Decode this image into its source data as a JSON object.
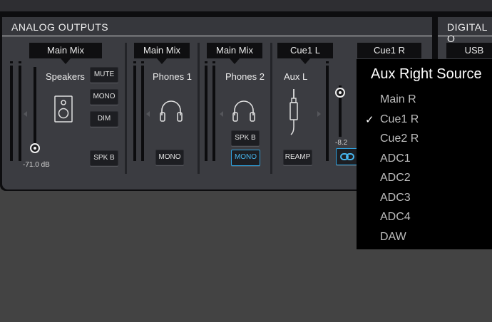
{
  "sections": {
    "analog_title": "ANALOG OUTPUTS",
    "digital_title": "DIGITAL O"
  },
  "channels": {
    "speakers": {
      "source": "Main Mix",
      "name": "Speakers",
      "value": "-71.0 dB",
      "mute": "MUTE",
      "mono": "MONO",
      "dim": "DIM",
      "spkb": "SPK B"
    },
    "phones1": {
      "source": "Main Mix",
      "name": "Phones 1",
      "mono": "MONO"
    },
    "phones2": {
      "source": "Main Mix",
      "name": "Phones 2",
      "spkb": "SPK B",
      "mono": "MONO"
    },
    "auxl": {
      "source": "Cue1 L",
      "name": "Aux L",
      "reamp": "REAMP",
      "value": "-8.2"
    },
    "auxr": {
      "source": "Cue1 R"
    },
    "digital": {
      "source": "USB"
    }
  },
  "popup": {
    "title": "Aux Right Source",
    "check_mark": "✓",
    "selected": "Cue1 R",
    "options": [
      "Main R",
      "Cue1 R",
      "Cue2 R",
      "ADC1",
      "ADC2",
      "ADC3",
      "ADC4",
      "DAW"
    ]
  },
  "colors": {
    "accent": "#2ea2df",
    "panel": "#3b3c41",
    "background": "#434343"
  },
  "icons": [
    "speaker-icon",
    "headphones-icon",
    "jack-cable-icon",
    "link-icon"
  ]
}
